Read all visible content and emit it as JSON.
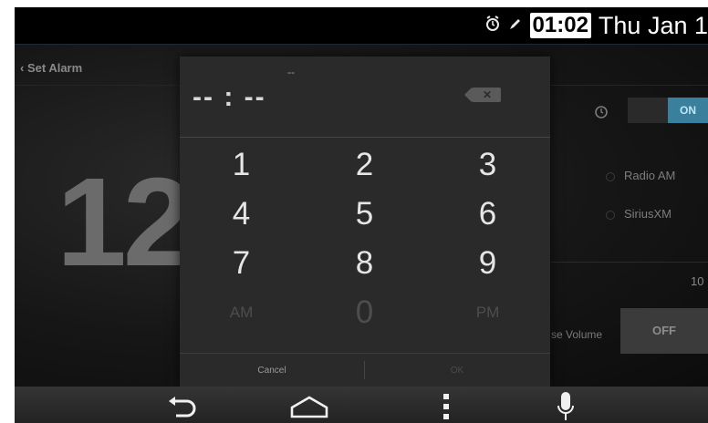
{
  "status_bar": {
    "time": "01:02",
    "date": "Thu Jan 1",
    "icons": [
      "alarm-icon",
      "pen-icon"
    ]
  },
  "app": {
    "title": "Set Alarm",
    "big_hour": "12",
    "radio_options": [
      "Radio AM",
      "SiriusXM"
    ],
    "volume_value": "10",
    "volume_label": "se Volume",
    "off_button": "OFF",
    "toggle_label": "ON"
  },
  "dialog": {
    "time_display": "-- : --",
    "ampm_hint": "--",
    "keys": [
      "1",
      "2",
      "3",
      "4",
      "5",
      "6",
      "7",
      "8",
      "9",
      "AM",
      "0",
      "PM"
    ],
    "cancel_label": "Cancel",
    "ok_label": "OK"
  },
  "navbar": {
    "icons": [
      "back-icon",
      "home-icon",
      "menu-icon",
      "mic-icon"
    ]
  }
}
